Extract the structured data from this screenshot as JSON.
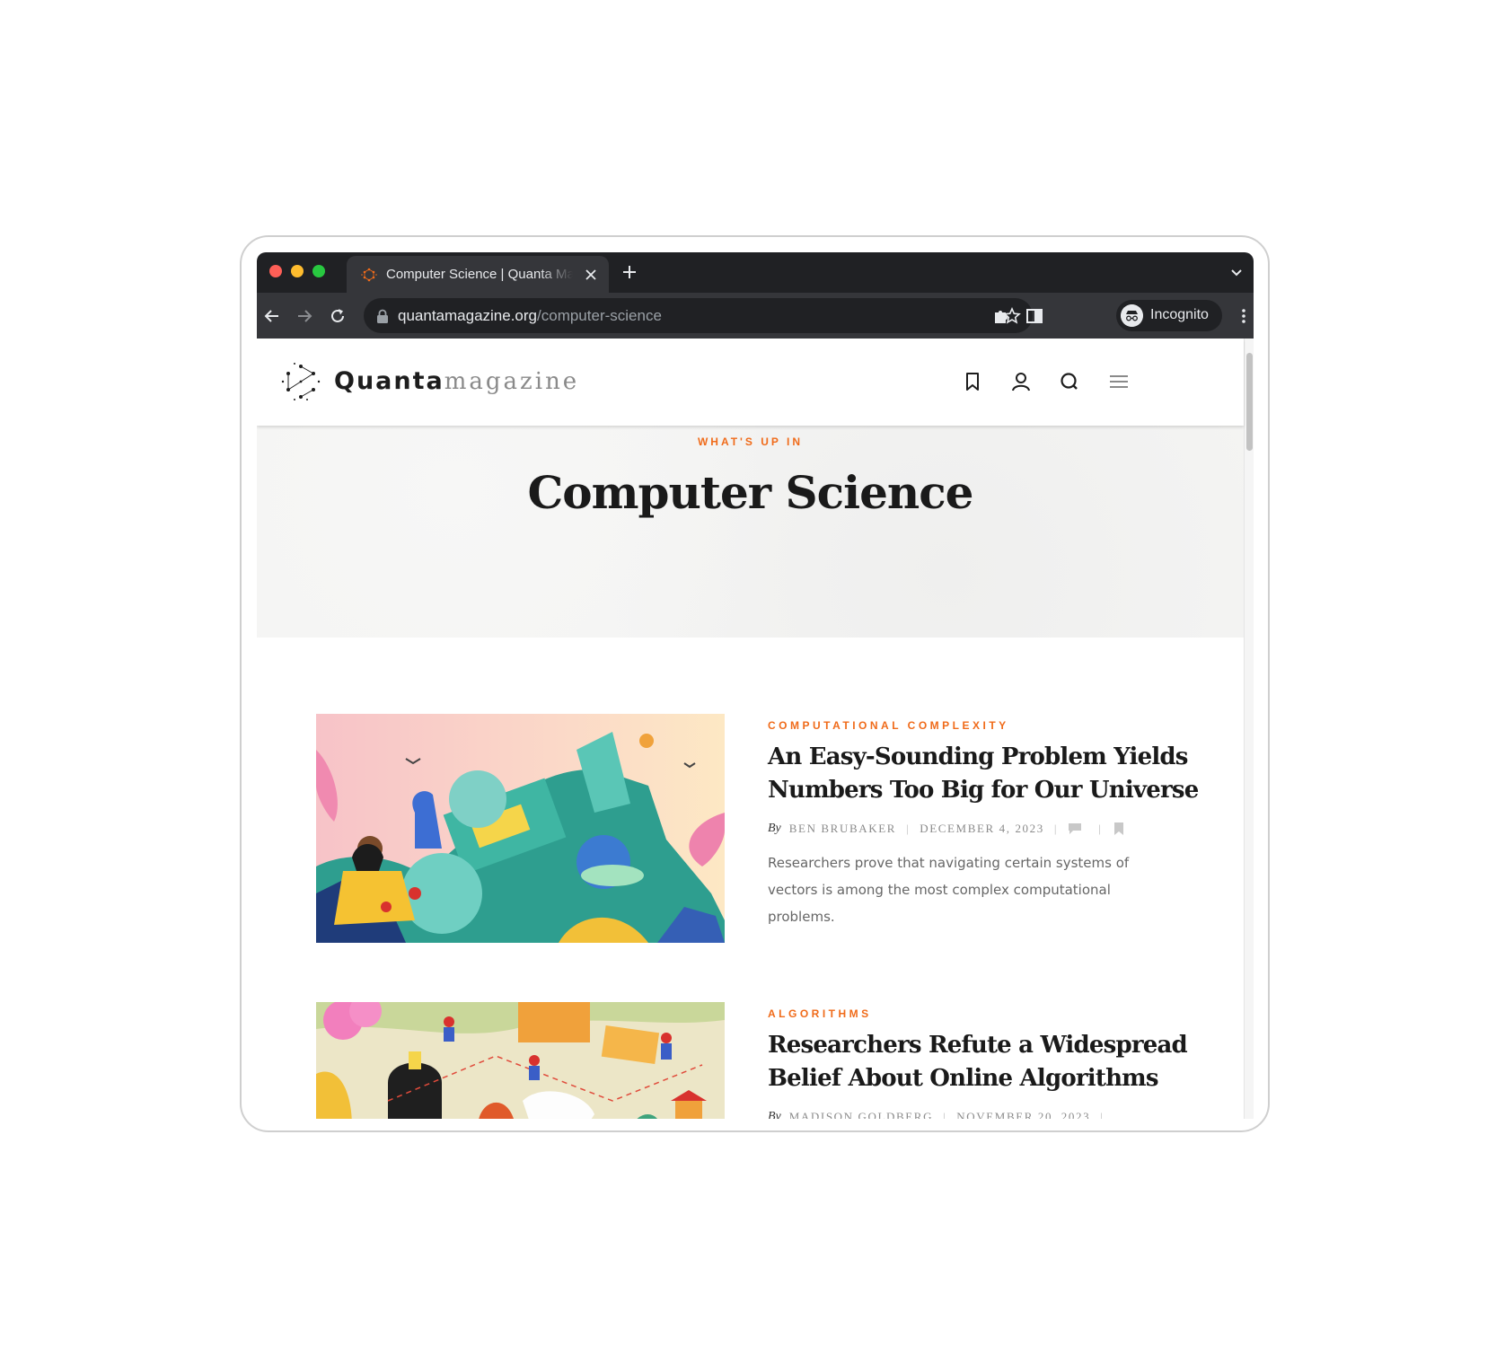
{
  "browser": {
    "tab_title": "Computer Science | Quanta Magazine",
    "url_domain": "quantamagazine.org",
    "url_path": "/computer-science",
    "incognito_label": "Incognito"
  },
  "site": {
    "logo_quanta": "Quanta",
    "logo_magazine": "magazine"
  },
  "hero": {
    "eyebrow": "WHAT'S UP IN",
    "title": "Computer Science"
  },
  "articles": [
    {
      "category": "COMPUTATIONAL COMPLEXITY",
      "title": "An Easy-Sounding Problem Yields Numbers Too Big for Our Universe",
      "by": "By",
      "author": "BEN BRUBAKER",
      "date": "DECEMBER 4, 2023",
      "description": "Researchers prove that navigating certain systems of vectors is among the most complex computational problems."
    },
    {
      "category": "ALGORITHMS",
      "title": "Researchers Refute a Widespread Belief About Online Algorithms",
      "by": "By",
      "author": "MADISON GOLDBERG",
      "date": "NOVEMBER 20, 2023"
    }
  ],
  "colors": {
    "accent": "#f06b1a",
    "chrome_dark": "#202124",
    "chrome_toolbar": "#35363a"
  }
}
